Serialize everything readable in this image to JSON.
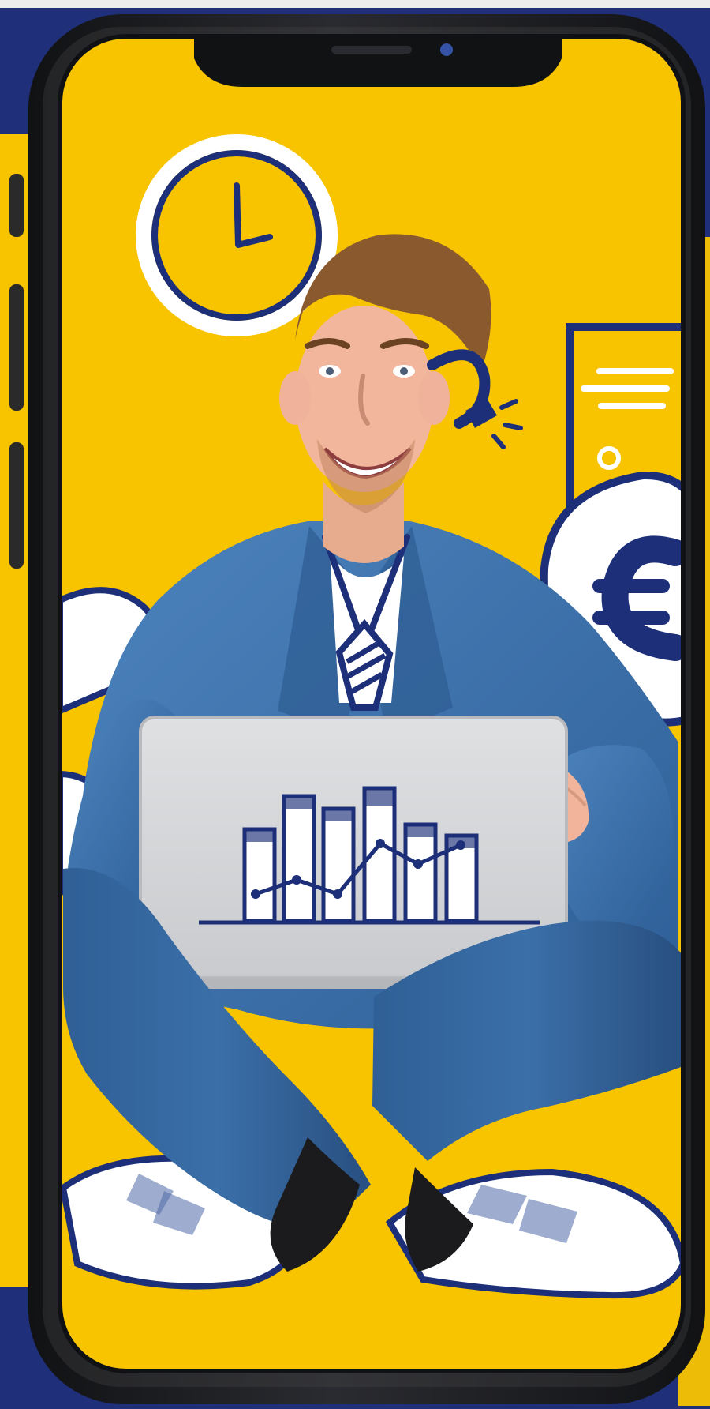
{
  "theme": {
    "navy": "#1c2f78",
    "yellow": "#f8c400",
    "phone_frame": "#1b1c20",
    "laptop_silver": "#d5d6d8",
    "denim": "#3b6ea8",
    "shirt": "#ffffff",
    "skin": "#f0b59a",
    "hair": "#8a5a2e"
  },
  "scene": {
    "background_icons": [
      "clock-icon",
      "document-icon",
      "euro-bubble-icon"
    ],
    "subject": "smiling-man-with-laptop",
    "laptop_graphic": "bar-and-line-chart-icon"
  }
}
